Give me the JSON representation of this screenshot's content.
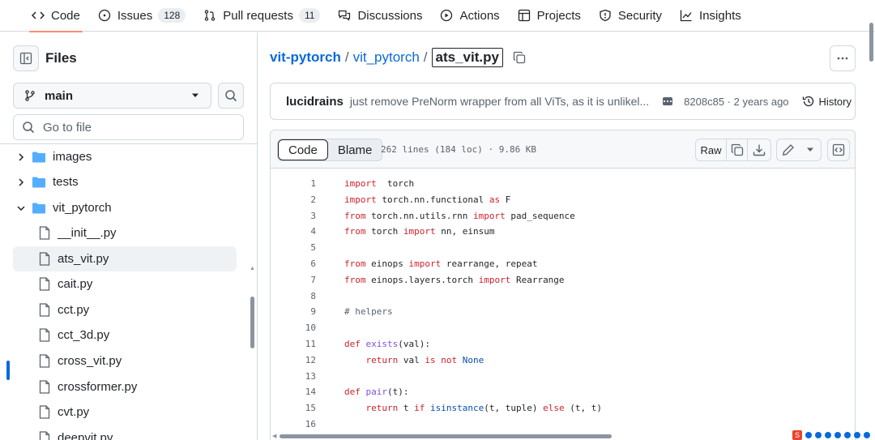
{
  "repo_nav": [
    {
      "label": "Code",
      "icon": "code-icon"
    },
    {
      "label": "Issues",
      "count": "128",
      "icon": "issue-icon"
    },
    {
      "label": "Pull requests",
      "count": "11",
      "icon": "pull-request-icon"
    },
    {
      "label": "Discussions",
      "icon": "discussions-icon"
    },
    {
      "label": "Actions",
      "icon": "play-icon"
    },
    {
      "label": "Projects",
      "icon": "table-icon"
    },
    {
      "label": "Security",
      "icon": "shield-icon"
    },
    {
      "label": "Insights",
      "icon": "graph-icon"
    }
  ],
  "sidebar": {
    "title": "Files",
    "branch": "main",
    "goto_placeholder": "Go to file",
    "tree": [
      {
        "label": "images",
        "type": "folder",
        "expanded": false
      },
      {
        "label": "tests",
        "type": "folder",
        "expanded": false
      },
      {
        "label": "vit_pytorch",
        "type": "folder",
        "expanded": true
      },
      {
        "label": "__init__.py",
        "type": "file"
      },
      {
        "label": "ats_vit.py",
        "type": "file",
        "selected": true
      },
      {
        "label": "cait.py",
        "type": "file"
      },
      {
        "label": "cct.py",
        "type": "file"
      },
      {
        "label": "cct_3d.py",
        "type": "file"
      },
      {
        "label": "cross_vit.py",
        "type": "file"
      },
      {
        "label": "crossformer.py",
        "type": "file"
      },
      {
        "label": "cvt.py",
        "type": "file"
      },
      {
        "label": "deepvit.py",
        "type": "file"
      }
    ]
  },
  "breadcrumb": {
    "repo": "vit-pytorch",
    "sep1": "/",
    "folder": "vit_pytorch",
    "sep2": "/",
    "file": "ats_vit.py"
  },
  "commit": {
    "author": "lucidrains",
    "message": "just remove PreNorm wrapper from all ViTs, as it is unlikel...",
    "meta": "8208c85 · 2 years ago",
    "history_label": "History"
  },
  "file_header": {
    "tab_code": "Code",
    "tab_blame": "Blame",
    "info": "262 lines (184 loc) · 9.86 KB",
    "raw_label": "Raw"
  },
  "code_lines": [
    {
      "n": "1",
      "tokens": [
        [
          "kw",
          "import"
        ],
        [
          "",
          "  torch"
        ]
      ]
    },
    {
      "n": "2",
      "tokens": [
        [
          "kw",
          "import"
        ],
        [
          "",
          " torch.nn.functional "
        ],
        [
          "kw",
          "as"
        ],
        [
          "",
          " F"
        ]
      ]
    },
    {
      "n": "3",
      "tokens": [
        [
          "kw",
          "from"
        ],
        [
          "",
          " torch.nn.utils.rnn "
        ],
        [
          "kw",
          "import"
        ],
        [
          "",
          " pad_sequence"
        ]
      ]
    },
    {
      "n": "4",
      "tokens": [
        [
          "kw",
          "from"
        ],
        [
          "",
          " torch "
        ],
        [
          "kw",
          "import"
        ],
        [
          "",
          " nn, einsum"
        ]
      ]
    },
    {
      "n": "5",
      "tokens": []
    },
    {
      "n": "6",
      "tokens": [
        [
          "kw",
          "from"
        ],
        [
          "",
          " einops "
        ],
        [
          "kw",
          "import"
        ],
        [
          "",
          " rearrange, repeat"
        ]
      ]
    },
    {
      "n": "7",
      "tokens": [
        [
          "kw",
          "from"
        ],
        [
          "",
          " einops.layers.torch "
        ],
        [
          "kw",
          "import"
        ],
        [
          "",
          " Rearrange"
        ]
      ]
    },
    {
      "n": "8",
      "tokens": []
    },
    {
      "n": "9",
      "tokens": [
        [
          "co",
          "# helpers"
        ]
      ]
    },
    {
      "n": "10",
      "tokens": []
    },
    {
      "n": "11",
      "tokens": [
        [
          "kw",
          "def"
        ],
        [
          "",
          " "
        ],
        [
          "fn",
          "exists"
        ],
        [
          "",
          "(val):"
        ]
      ]
    },
    {
      "n": "12",
      "tokens": [
        [
          "",
          "    "
        ],
        [
          "kw",
          "return"
        ],
        [
          "",
          " val "
        ],
        [
          "kw",
          "is not"
        ],
        [
          "",
          " "
        ],
        [
          "nm",
          "None"
        ]
      ]
    },
    {
      "n": "13",
      "tokens": []
    },
    {
      "n": "14",
      "tokens": [
        [
          "kw",
          "def"
        ],
        [
          "",
          " "
        ],
        [
          "fn",
          "pair"
        ],
        [
          "",
          "(t):"
        ]
      ]
    },
    {
      "n": "15",
      "tokens": [
        [
          "",
          "    "
        ],
        [
          "kw",
          "return"
        ],
        [
          "",
          " t "
        ],
        [
          "kw",
          "if"
        ],
        [
          "",
          " "
        ],
        [
          "nm",
          "isinstance"
        ],
        [
          "",
          "(t, tuple) "
        ],
        [
          "kw",
          "else"
        ],
        [
          "",
          " (t, t)"
        ]
      ]
    },
    {
      "n": "16",
      "tokens": []
    }
  ],
  "colors": {
    "accent": "#0969da",
    "active_tab_underline": "#fd8c73",
    "keyword": "#cf222e",
    "function": "#8250df",
    "constant": "#0550ae"
  }
}
